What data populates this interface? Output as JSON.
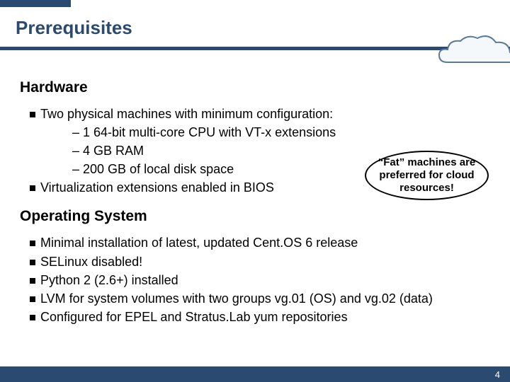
{
  "slide": {
    "title": "Prerequisites",
    "pageNumber": "4"
  },
  "hardware": {
    "heading": "Hardware",
    "intro": "Two physical machines with minimum configuration:",
    "specs": {
      "cpu": "1 64-bit multi-core CPU with VT-x extensions",
      "ram": "4 GB RAM",
      "disk": "200 GB of local disk space"
    },
    "bios": "Virtualization extensions enabled in BIOS"
  },
  "callout": {
    "text": "“Fat” machines are preferred for cloud resources!"
  },
  "os": {
    "heading": "Operating System",
    "items": {
      "install": "Minimal installation of latest, updated Cent.OS 6 release",
      "selinux": "SELinux disabled!",
      "python": "Python 2 (2.6+) installed",
      "lvm": "LVM for system volumes with two groups vg.01 (OS) and vg.02 (data)",
      "repos": "Configured for EPEL and Stratus.Lab yum repositories"
    }
  }
}
